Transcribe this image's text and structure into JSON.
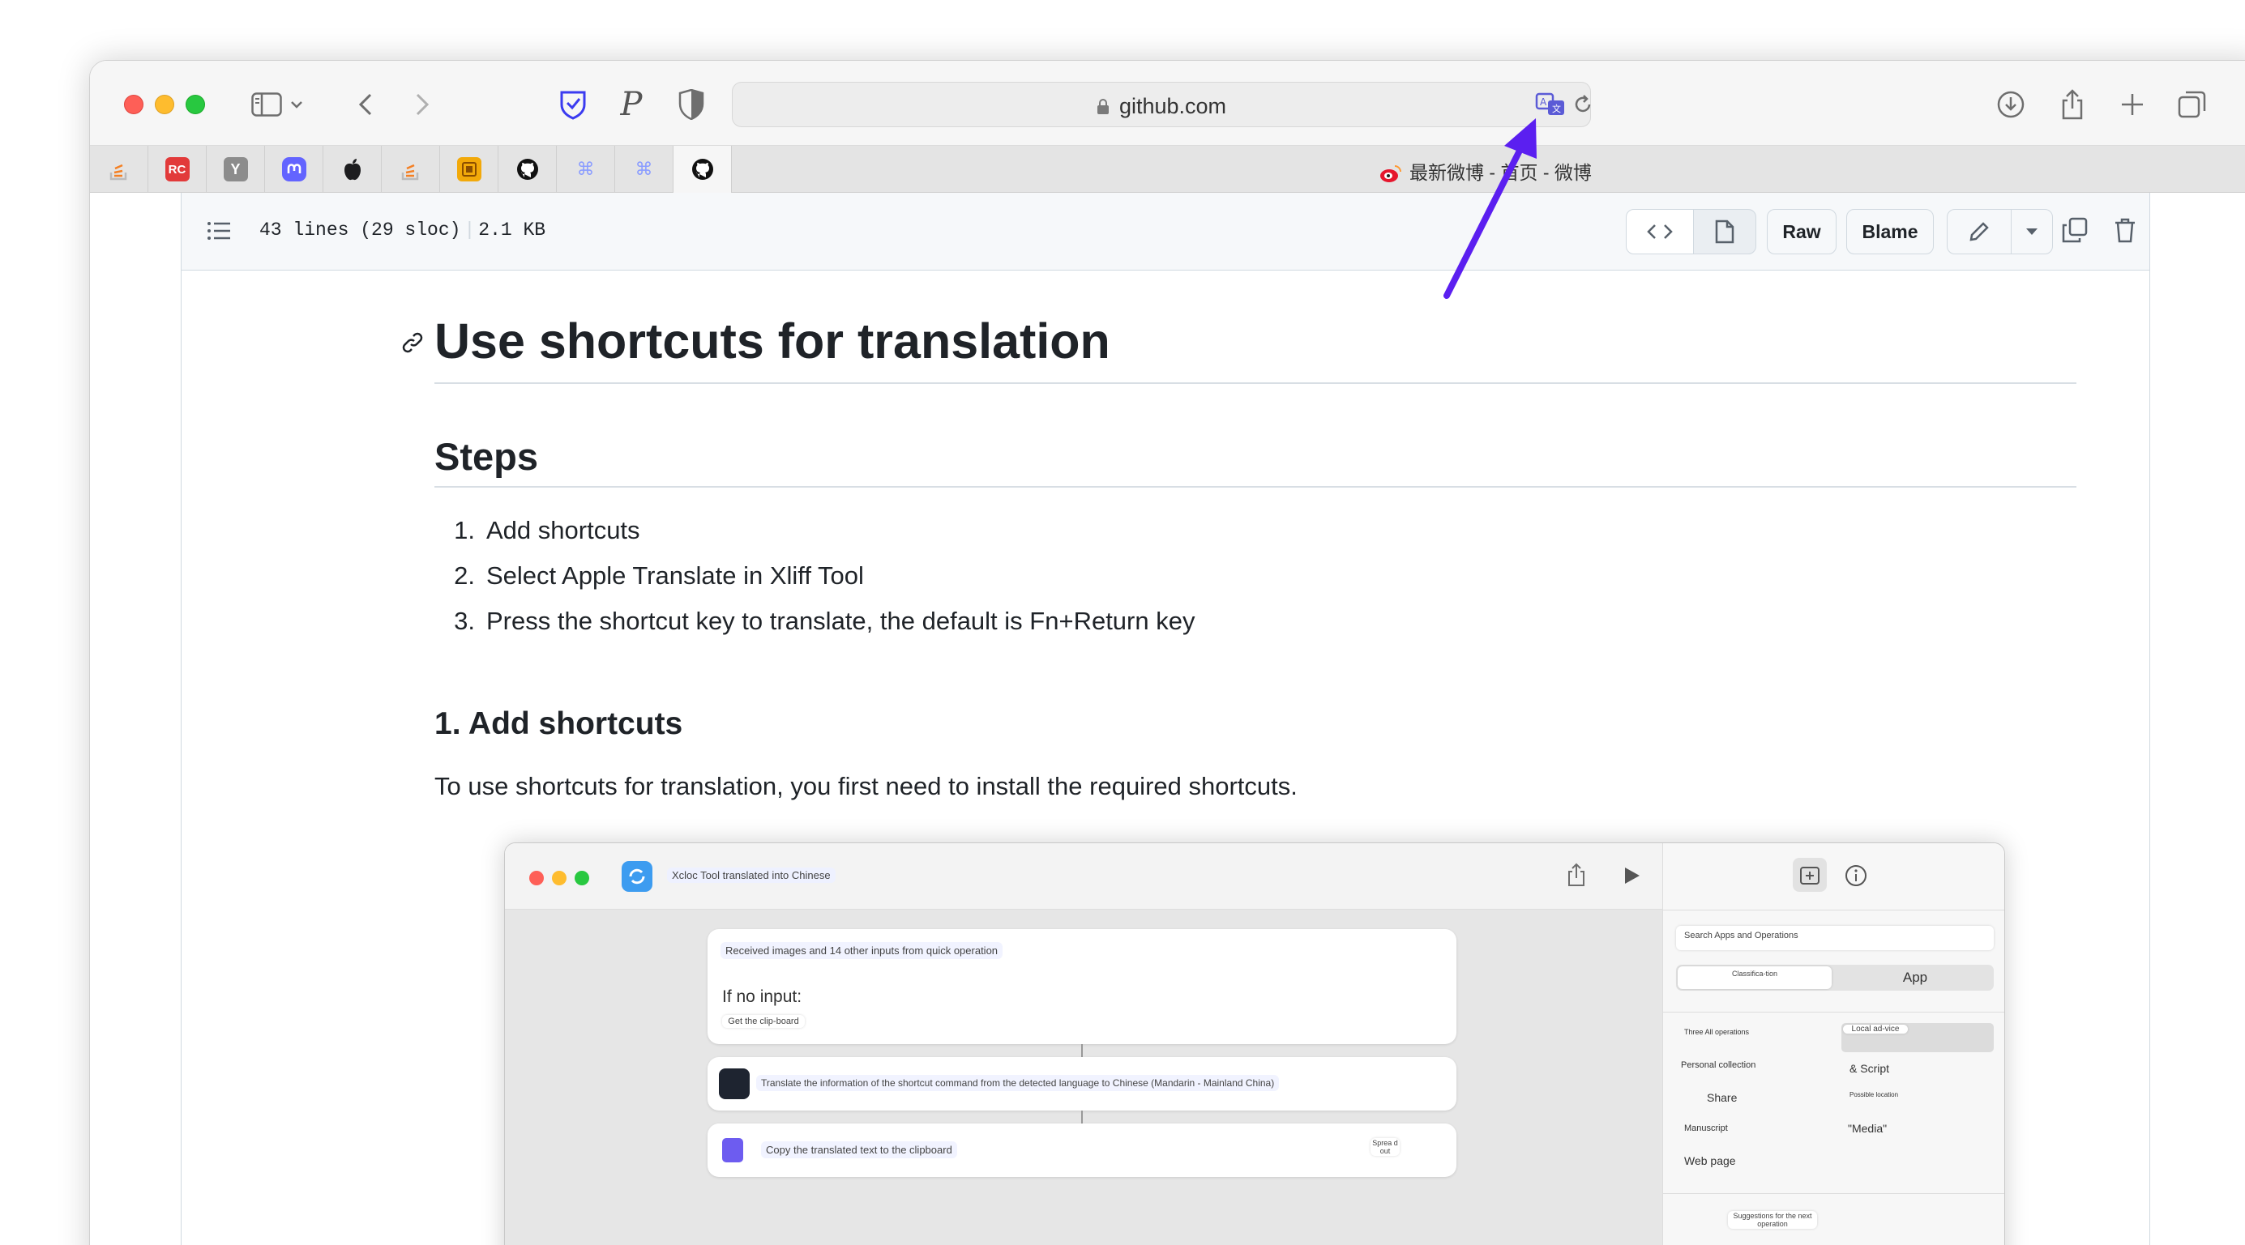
{
  "browser": {
    "url": "github.com",
    "tab_title": "最新微博 - 首页 - 微博",
    "pinned_tabs": [
      {
        "name": "stackoverflow",
        "label": "",
        "color": "#f48024"
      },
      {
        "name": "rc",
        "label": "RC",
        "color": "#e23a3a"
      },
      {
        "name": "hacker-news",
        "label": "Y",
        "color": "#8c8c8c"
      },
      {
        "name": "mastodon",
        "label": "",
        "color": "#6364ff"
      },
      {
        "name": "apple",
        "label": "",
        "color": "#222222"
      },
      {
        "name": "stackoverflow-2",
        "label": "",
        "color": "#f48024"
      },
      {
        "name": "bookmark-app",
        "label": "",
        "color": "#f2a90a"
      },
      {
        "name": "github",
        "label": "",
        "color": "#111111"
      },
      {
        "name": "command-1",
        "label": "⌘",
        "color": "#8b9dff"
      },
      {
        "name": "command-2",
        "label": "⌘",
        "color": "#8b9dff"
      },
      {
        "name": "github-active",
        "label": "",
        "color": "#111111"
      }
    ]
  },
  "file_header": {
    "lines": "43 lines (29 sloc)",
    "size": "2.1 KB",
    "raw_label": "Raw",
    "blame_label": "Blame"
  },
  "doc": {
    "title": "Use shortcuts for translation",
    "steps_heading": "Steps",
    "steps": [
      {
        "num": "1.",
        "text": "Add shortcuts"
      },
      {
        "num": "2.",
        "text": "Select Apple Translate in Xliff Tool"
      },
      {
        "num": "3.",
        "text": "Press the shortcut key to translate, the default is Fn+Return key"
      }
    ],
    "section1_heading": "1. Add shortcuts",
    "section1_text": "To use shortcuts for translation, you first need to install the required shortcuts."
  },
  "screenshot": {
    "title": "Xcloc Tool translated into Chinese",
    "card1_line": "Received images and 14 other inputs from quick operation",
    "card1_no_input": "If no input:",
    "card1_pill": "Get the clip-board",
    "card2_line": "Translate the information of the shortcut command from the detected language to Chinese (Mandarin - Mainland China)",
    "card3_line": "Copy the translated text to the clipboard",
    "card3_pill": "Sprea d out",
    "search_placeholder": "Search Apps and Operations",
    "seg_left": "Classifica-tion",
    "seg_right": "App",
    "side_items_left": [
      "Three All operations",
      "Personal collection",
      "Share",
      "Manuscript",
      "Web page"
    ],
    "side_items_right": [
      "Local ad-vice",
      "& Script",
      "Possible location",
      "\"Media\""
    ],
    "suggestion": "Suggestions for the next operation"
  },
  "colors": {
    "arrow": "#5b1ff0",
    "link": "#0969da"
  }
}
